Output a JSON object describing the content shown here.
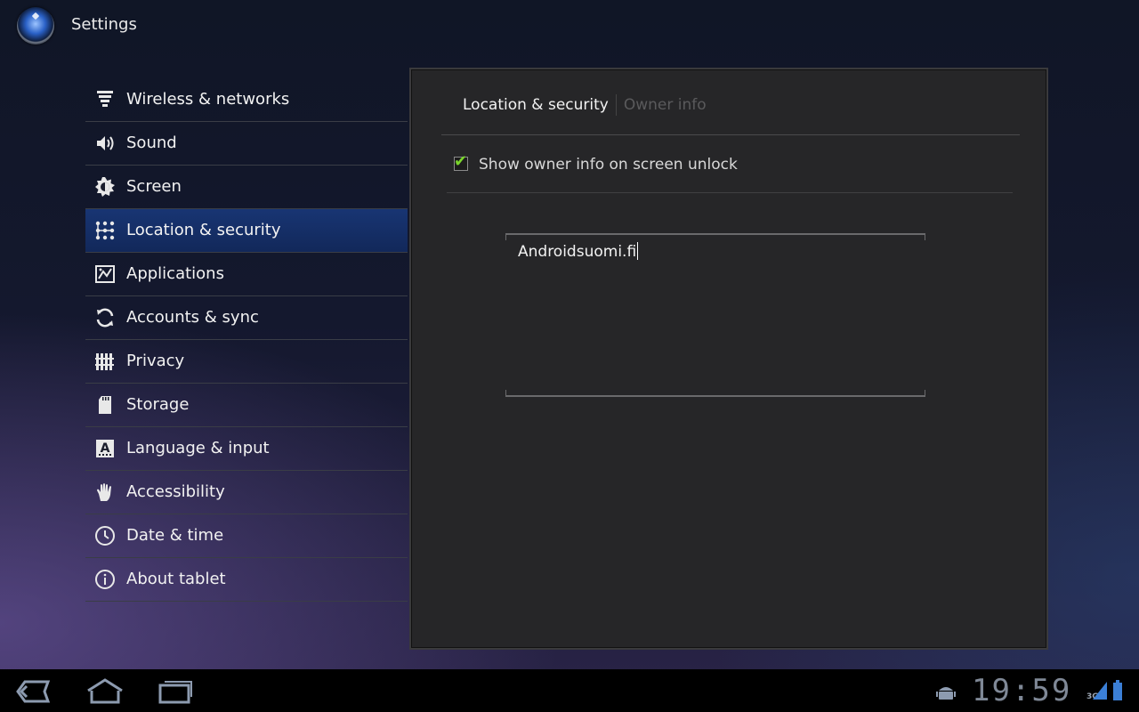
{
  "app": {
    "title": "Settings"
  },
  "sidebar": {
    "items": [
      {
        "label": "Wireless & networks",
        "icon": "wifi-signal-icon"
      },
      {
        "label": "Sound",
        "icon": "speaker-icon"
      },
      {
        "label": "Screen",
        "icon": "brightness-icon"
      },
      {
        "label": "Location & security",
        "icon": "pattern-lock-icon",
        "selected": true
      },
      {
        "label": "Applications",
        "icon": "applications-icon"
      },
      {
        "label": "Accounts & sync",
        "icon": "sync-icon"
      },
      {
        "label": "Privacy",
        "icon": "privacy-fence-icon"
      },
      {
        "label": "Storage",
        "icon": "sd-card-icon"
      },
      {
        "label": "Language & input",
        "icon": "language-icon"
      },
      {
        "label": "Accessibility",
        "icon": "hand-icon"
      },
      {
        "label": "Date & time",
        "icon": "clock-icon"
      },
      {
        "label": "About tablet",
        "icon": "info-icon"
      }
    ]
  },
  "panel": {
    "breadcrumb": {
      "current": "Location & security",
      "next": "Owner info"
    },
    "preference": {
      "label": "Show owner info on screen unlock",
      "checked": true
    },
    "owner_text": "Androidsuomi.fi"
  },
  "system_bar": {
    "time": "19:59",
    "network": "3G"
  },
  "colors": {
    "selected_item": "#183573",
    "check_accent": "#7ad52c"
  }
}
